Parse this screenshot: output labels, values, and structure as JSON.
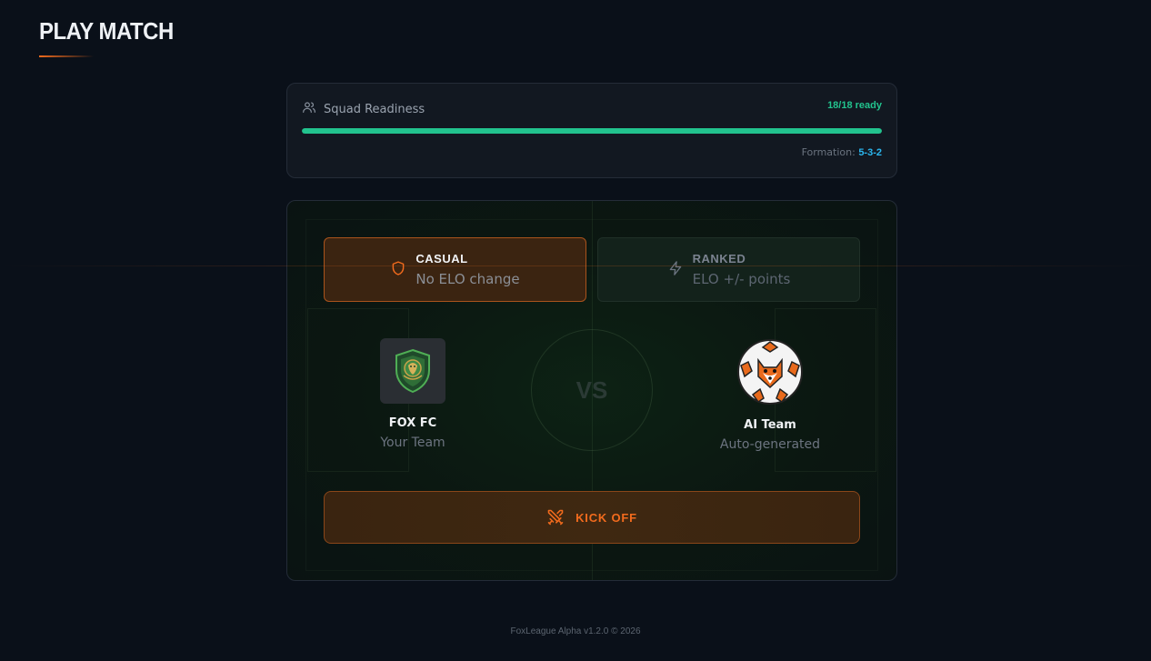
{
  "page": {
    "title": "PLAY MATCH"
  },
  "readiness": {
    "label": "Squad Readiness",
    "count_text": "18/18 ready",
    "ready": 18,
    "total": 18,
    "formation_label": "Formation:",
    "formation_value": "5-3-2",
    "bar_color": "#22c38e"
  },
  "modes": {
    "casual": {
      "label": "CASUAL",
      "sub": "No ELO change",
      "icon": "shield-icon",
      "selected": true
    },
    "ranked": {
      "label": "RANKED",
      "sub": "ELO +/- points",
      "icon": "lightning-icon",
      "selected": false
    }
  },
  "match": {
    "home": {
      "name": "FOX FC",
      "sub": "Your Team",
      "icon": "lion-crest-icon"
    },
    "away": {
      "name": "AI Team",
      "sub": "Auto-generated",
      "icon": "fox-ball-icon"
    },
    "vs_label": "VS"
  },
  "kickoff": {
    "label": "KICK OFF",
    "icon": "crossed-swords-icon"
  },
  "footer": {
    "text": "FoxLeague Alpha v1.2.0 © 2026"
  },
  "colors": {
    "accent": "#f26b1d",
    "success": "#22c38e",
    "info": "#2bb6ee",
    "background": "#0a1019"
  }
}
